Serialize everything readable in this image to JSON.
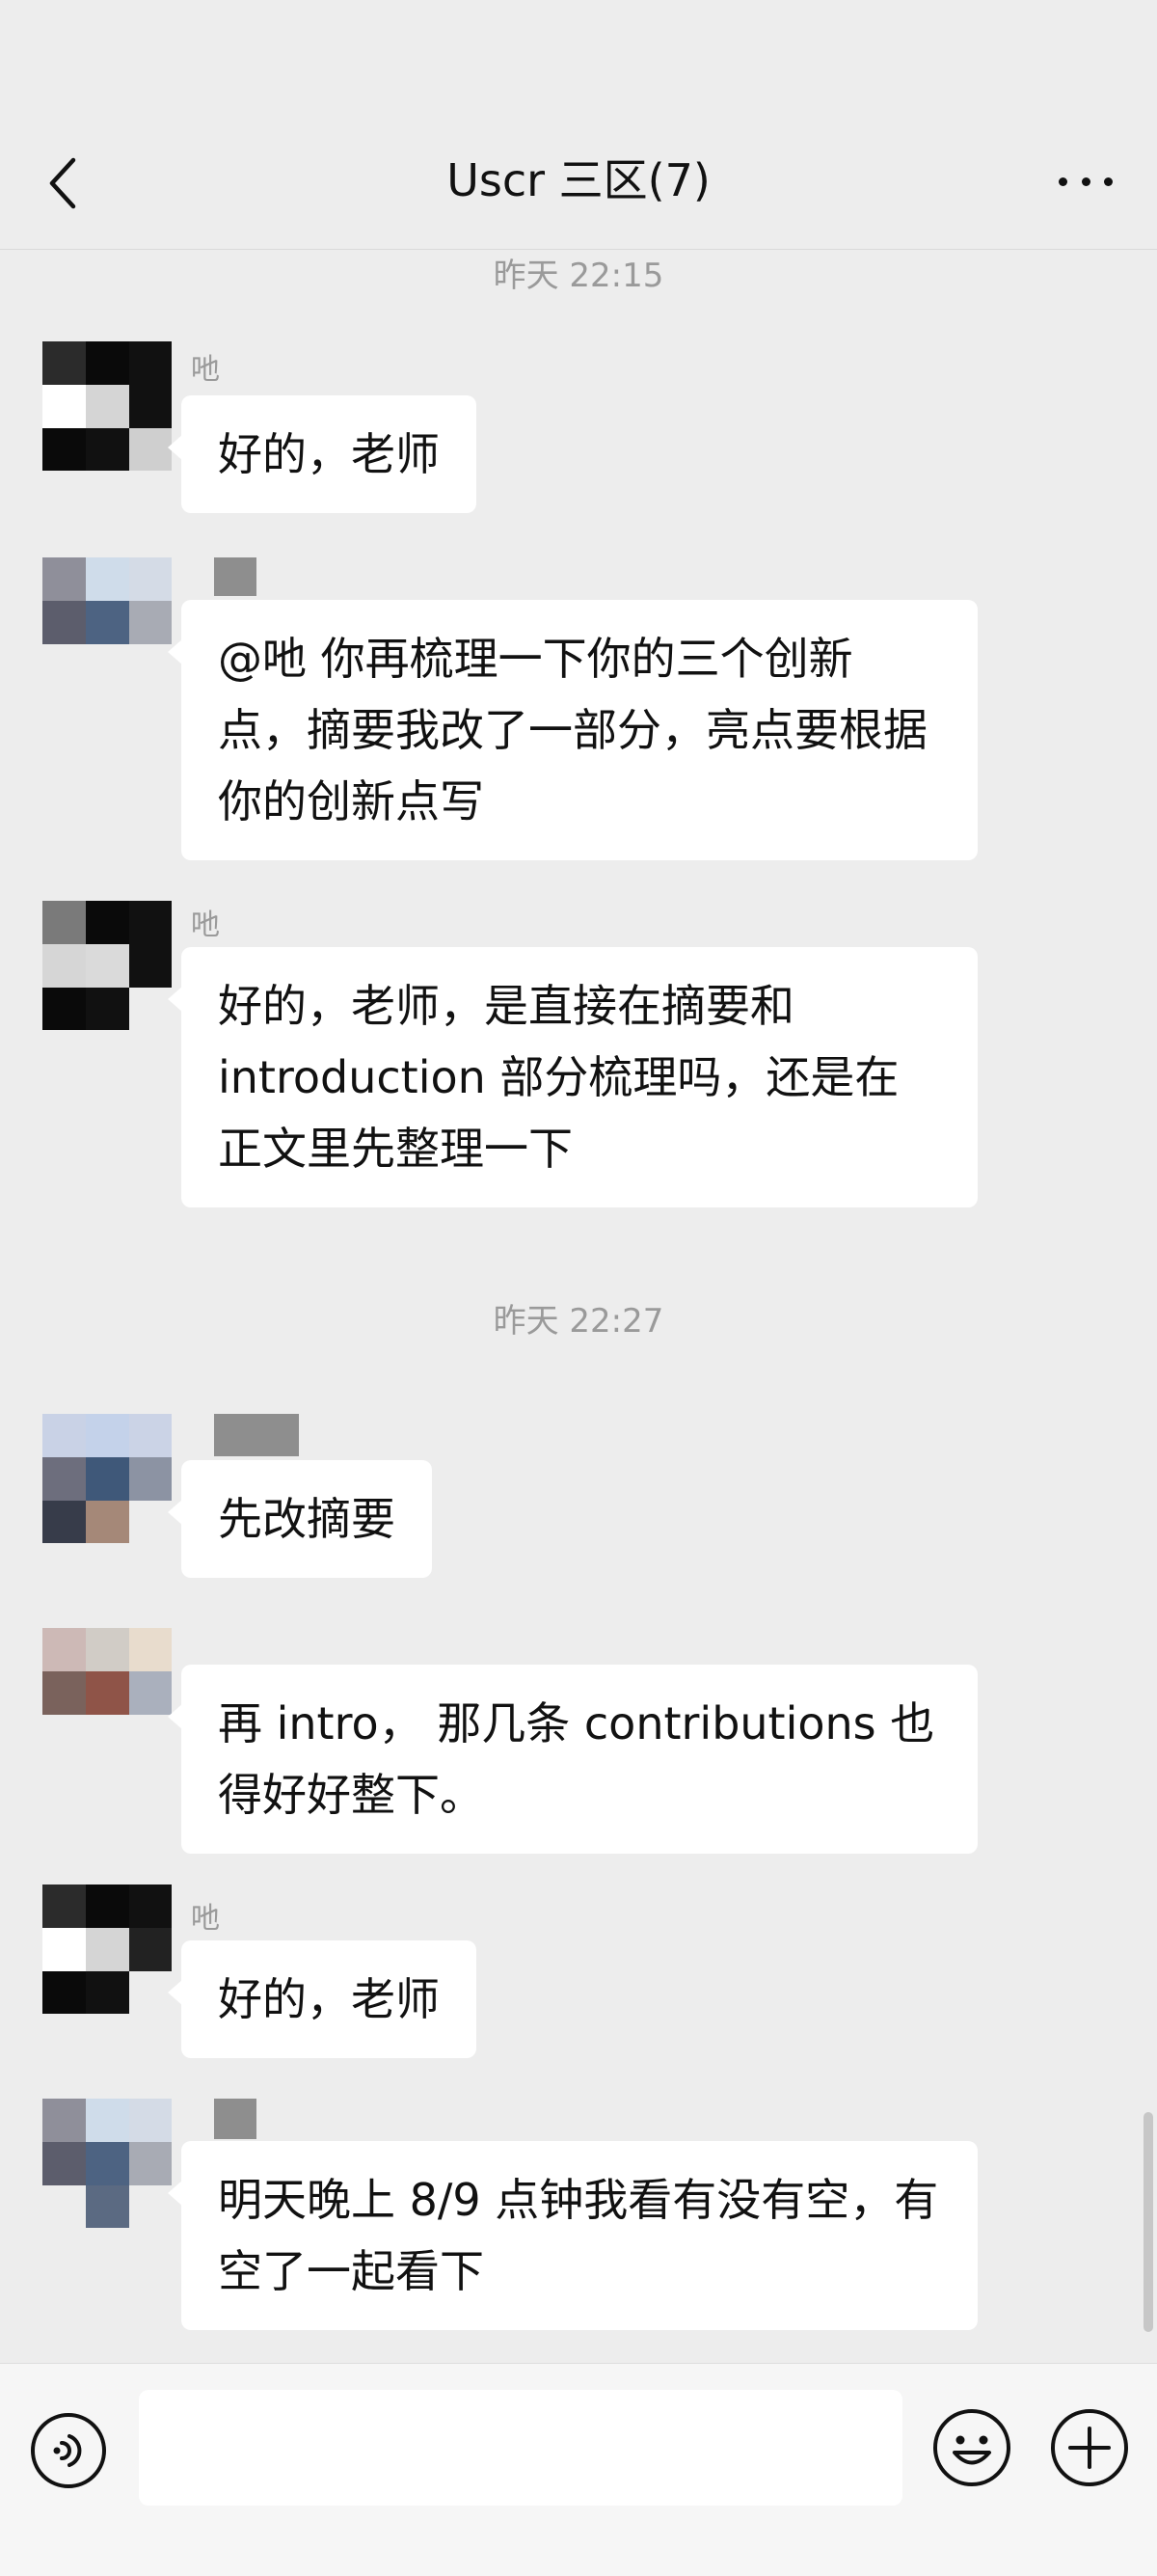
{
  "header": {
    "title": "Uscr 三区(7)"
  },
  "chat": {
    "top_time": "昨天 22:15",
    "time_2": "昨天 22:27",
    "messages": [
      {
        "sender": "吔",
        "text": "好的，老师"
      },
      {
        "sender": "",
        "text": "@吔  你再梳理一下你的三个创新点，摘要我改了一部分，亮点要根据你的创新点写"
      },
      {
        "sender": "吔",
        "text": "好的，老师，是直接在摘要和introduction 部分梳理吗，还是在正文里先整理一下"
      },
      {
        "sender": "",
        "text": "先改摘要"
      },
      {
        "sender": "",
        "text": "再 intro，  那几条 contributions 也得好好整下。"
      },
      {
        "sender": "吔",
        "text": "好的，老师"
      },
      {
        "sender": "",
        "text": "明天晚上 8/9 点钟我看有没有空，有空了一起看下"
      }
    ]
  },
  "icons": {
    "back": "chevron-left-icon",
    "more": "more-dots-icon",
    "voice": "voice-icon",
    "emoji": "emoji-icon",
    "plus": "plus-icon"
  },
  "input": {
    "value": ""
  }
}
